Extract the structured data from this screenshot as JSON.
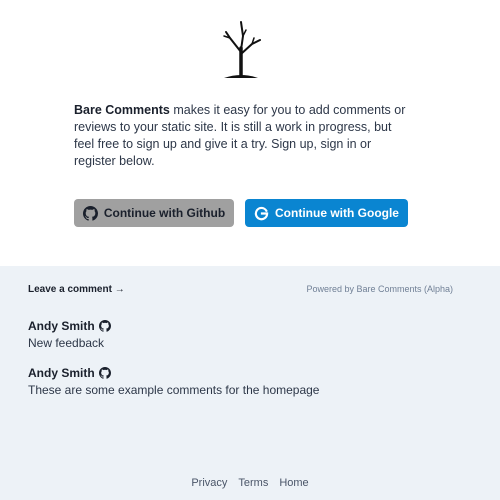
{
  "intro": {
    "brand": "Bare Comments",
    "text": " makes it easy for you to add comments or reviews to your static site. It is still a work in progress, but feel free to sign up and give it a try. Sign up, sign in or register below."
  },
  "auth": {
    "github_label": "Continue with Github",
    "google_label": "Continue with Google"
  },
  "comments_section": {
    "leave_comment": "Leave a comment →",
    "powered_by": "Powered by Bare Comments (Alpha)",
    "comments": [
      {
        "author": "Andy Smith",
        "text": "New feedback"
      },
      {
        "author": "Andy Smith",
        "text": "These are some example comments for the homepage"
      }
    ]
  },
  "footer": {
    "links": [
      "Privacy",
      "Terms",
      "Home"
    ]
  },
  "colors": {
    "github_button": "#a0a0a0",
    "google_button": "#0a85d1",
    "section_background": "#edf2f7"
  },
  "icons": {
    "logo": "bare-tree-icon",
    "github": "github-icon",
    "google": "google-g-icon"
  }
}
